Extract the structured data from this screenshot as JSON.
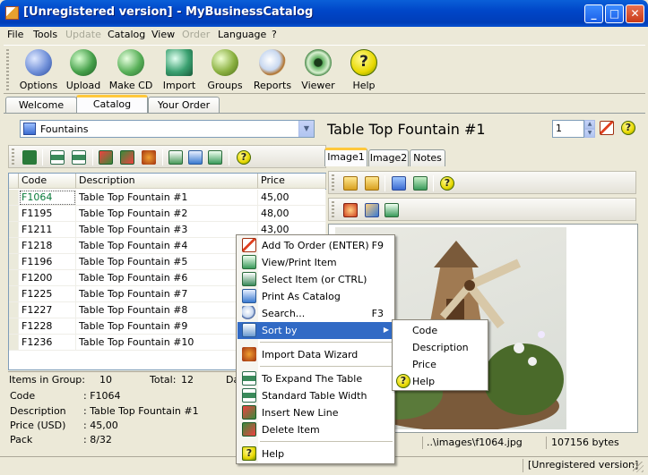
{
  "window": {
    "title": "[Unregistered version] - MyBusinessCatalog"
  },
  "menu": [
    {
      "label": "File",
      "enabled": true
    },
    {
      "label": "Tools",
      "enabled": true
    },
    {
      "label": "Update",
      "enabled": false
    },
    {
      "label": "Catalog",
      "enabled": true
    },
    {
      "label": "View",
      "enabled": true
    },
    {
      "label": "Order",
      "enabled": false
    },
    {
      "label": "Language",
      "enabled": true
    },
    {
      "label": "?",
      "enabled": true
    }
  ],
  "toolbar": {
    "options": "Options",
    "upload": "Upload",
    "make_cd": "Make CD",
    "import": "Import",
    "groups": "Groups",
    "reports": "Reports",
    "viewer": "Viewer",
    "help": "Help"
  },
  "tabs": {
    "welcome": "Welcome",
    "catalog": "Catalog",
    "your_order": "Your Order",
    "active": "Catalog"
  },
  "group_selector": {
    "value": "Fountains"
  },
  "grid": {
    "headers": {
      "code": "Code",
      "description": "Description",
      "price": "Price"
    },
    "rows": [
      {
        "code": "F1064",
        "description": "Table Top Fountain #1",
        "price": "45,00"
      },
      {
        "code": "F1195",
        "description": "Table Top Fountain #2",
        "price": "48,00"
      },
      {
        "code": "F1211",
        "description": "Table Top Fountain #3",
        "price": "43,00"
      },
      {
        "code": "F1218",
        "description": "Table Top Fountain #4",
        "price": ""
      },
      {
        "code": "F1196",
        "description": "Table Top Fountain #5",
        "price": ""
      },
      {
        "code": "F1200",
        "description": "Table Top Fountain #6",
        "price": ""
      },
      {
        "code": "F1225",
        "description": "Table Top Fountain #7",
        "price": ""
      },
      {
        "code": "F1227",
        "description": "Table Top Fountain #8",
        "price": ""
      },
      {
        "code": "F1228",
        "description": "Table Top Fountain #9",
        "price": ""
      },
      {
        "code": "F1236",
        "description": "Table Top Fountain #10",
        "price": ""
      }
    ]
  },
  "group_status": {
    "items_label": "Items in Group:",
    "items_value": "10",
    "total_label": "Total:",
    "total_value": "12",
    "truncated": "Da"
  },
  "details": {
    "code_label": "Code",
    "code_value": ": F1064",
    "description_label": "Description",
    "description_value": ": Table Top Fountain #1",
    "price_label": "Price (USD)",
    "price_value": ": 45,00",
    "pack_label": "Pack",
    "pack_value": ": 8/32"
  },
  "product": {
    "title": "Table Top Fountain #1",
    "quantity": "1"
  },
  "image_tabs": {
    "image1": "Image1",
    "image2": "Image2",
    "notes": "Notes"
  },
  "image_status": {
    "path": "..\\images\\f1064.jpg",
    "size": "107156 bytes"
  },
  "context_menu": {
    "add_to_order": "Add To Order (ENTER)",
    "add_to_order_key": "F9",
    "view_print": "View/Print Item",
    "select_item": "Select Item (or CTRL)",
    "print_catalog": "Print As Catalog",
    "search": "Search...",
    "search_key": "F3",
    "sort_by": "Sort by",
    "import_wizard": "Import Data Wizard",
    "expand_table": "To Expand The Table",
    "standard_width": "Standard Table Width",
    "insert_line": "Insert New Line",
    "delete_item": "Delete Item",
    "help": "Help"
  },
  "sort_submenu": {
    "code": "Code",
    "description": "Description",
    "price": "Price",
    "help": "Help"
  },
  "statusbar": {
    "text": "[Unregistered version]"
  },
  "colors": {
    "title_blue": "#0046c8",
    "highlight": "#316ac5",
    "selected_code": "#0a7a3a"
  }
}
